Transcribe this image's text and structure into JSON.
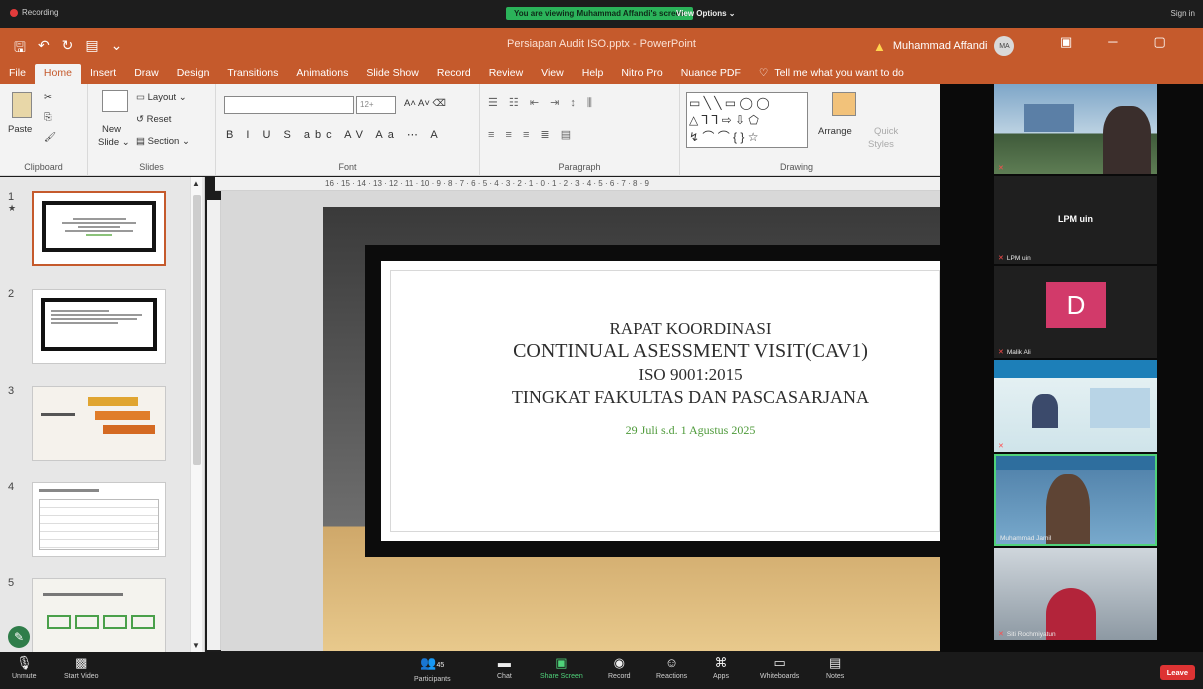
{
  "zoom": {
    "recording": "Recording",
    "viewing_banner": "You are viewing Muhammad Affandi's screen",
    "view_options": "View Options",
    "sign_in": "Sign in"
  },
  "powerpoint": {
    "doc_title": "Persiapan Audit ISO.pptx - PowerPoint",
    "user_name": "Muhammad Affandi",
    "user_initials": "MA",
    "tabs": [
      "File",
      "Home",
      "Insert",
      "Draw",
      "Design",
      "Transitions",
      "Animations",
      "Slide Show",
      "Record",
      "Review",
      "View",
      "Help",
      "Nitro Pro",
      "Nuance PDF"
    ],
    "tell_me": "Tell me what you want to do",
    "ribbon": {
      "paste": "Paste",
      "new_slide": "New",
      "new_slide2": "Slide",
      "layout": "Layout",
      "reset": "Reset",
      "section": "Section",
      "arrange": "Arrange",
      "quick": "Quick",
      "styles": "Styles",
      "groups": {
        "clipboard": "Clipboard",
        "slides": "Slides",
        "font": "Font",
        "paragraph": "Paragraph",
        "drawing": "Drawing"
      },
      "font_size": "12+"
    },
    "ruler": "16 · 15 · 14 · 13 · 12 · 11 · 10 · 9 · 8 · 7 · 6 · 5 · 4 · 3 · 2 · 1 · 0 · 1 · 2 · 3 · 4 · 5 · 6 · 7 · 8 · 9",
    "thumb_numbers": [
      "1",
      "2",
      "3",
      "4",
      "5"
    ],
    "slide": {
      "line1": "RAPAT KOORDINASI",
      "line2": "CONTINUAL ASESSMENT VISIT(CAV1)",
      "line3": "ISO 9001:2015",
      "line4": "TINGKAT FAKULTAS DAN PASCASARJANA",
      "date": "29 Juli s.d. 1 Agustus 2025",
      "date_color": "#4e9a3a"
    }
  },
  "participants": [
    {
      "label": "LPM uin",
      "name": "LPM uin"
    },
    {
      "initial": "D",
      "name": "Malik Ali",
      "color": "#d23a6a"
    },
    {
      "name": "Manajer Mutu"
    },
    {
      "name": "Muhammad Jamil"
    },
    {
      "name": "Siti Rochmiyatun"
    }
  ],
  "bottom_bar": {
    "unmute": "Unmute",
    "start_video": "Start Video",
    "participants": "Participants",
    "participants_count": "45",
    "chat": "Chat",
    "share": "Share Screen",
    "record": "Record",
    "reactions": "Reactions",
    "apps": "Apps",
    "whiteboards": "Whiteboards",
    "notes": "Notes",
    "leave": "Leave"
  }
}
